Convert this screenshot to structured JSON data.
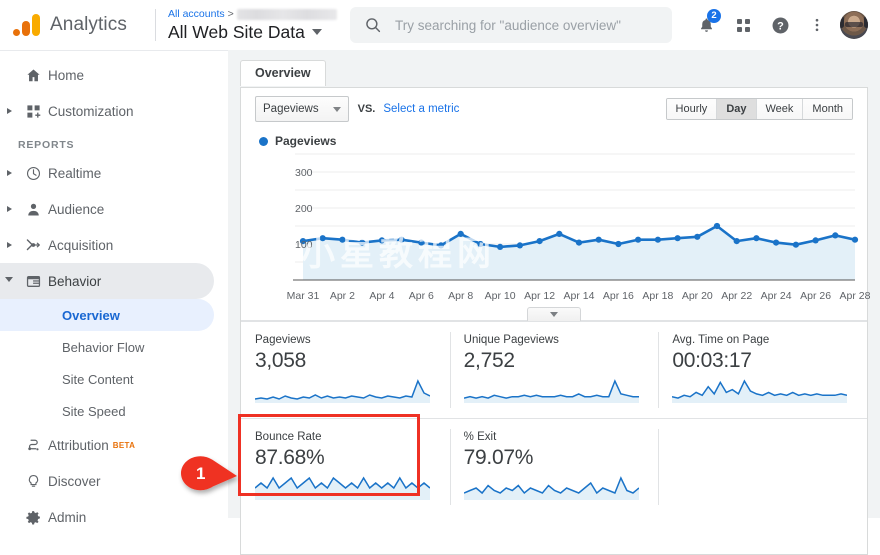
{
  "topbar": {
    "brand": "Analytics",
    "breadcrumb_root": "All accounts",
    "breadcrumb_sep": ">",
    "property_name": "All Web Site Data",
    "search_placeholder": "Try searching for \"audience overview\"",
    "notification_count": "2",
    "icons": {
      "search": "search-icon",
      "bell": "notifications-bell-icon",
      "apps": "apps-grid-icon",
      "help": "help-circle-icon",
      "more": "more-vertical-icon",
      "avatar": "user-avatar"
    }
  },
  "sidebar": {
    "top_items": [
      {
        "label": "Home",
        "icon": "home-icon",
        "expandable": false
      },
      {
        "label": "Customization",
        "icon": "customization-icon",
        "expandable": true
      }
    ],
    "section_label": "REPORTS",
    "report_items": [
      {
        "label": "Realtime",
        "icon": "clock-icon",
        "expandable": true
      },
      {
        "label": "Audience",
        "icon": "person-icon",
        "expandable": true
      },
      {
        "label": "Acquisition",
        "icon": "acquisition-icon",
        "expandable": true
      },
      {
        "label": "Behavior",
        "icon": "behavior-icon",
        "expandable": true,
        "expanded": true,
        "selected": true
      }
    ],
    "behavior_children": [
      {
        "label": "Overview",
        "active": true,
        "expandable": false
      },
      {
        "label": "Behavior Flow",
        "active": false,
        "expandable": false
      },
      {
        "label": "Site Content",
        "active": false,
        "expandable": true
      },
      {
        "label": "Site Speed",
        "active": false,
        "expandable": true
      }
    ],
    "bottom_items": [
      {
        "label": "Attribution",
        "icon": "attribution-icon",
        "badge": "BETA"
      },
      {
        "label": "Discover",
        "icon": "lightbulb-icon",
        "badge": ""
      },
      {
        "label": "Admin",
        "icon": "gear-icon",
        "badge": ""
      }
    ]
  },
  "main": {
    "tab_label": "Overview",
    "metric_select": "Pageviews",
    "vs_label": "VS.",
    "select_metric_link": "Select a metric",
    "granularity": [
      {
        "label": "Hourly",
        "selected": false
      },
      {
        "label": "Day",
        "selected": true
      },
      {
        "label": "Week",
        "selected": false
      },
      {
        "label": "Month",
        "selected": false
      }
    ],
    "legend_label": "Pageviews",
    "watermark": "小星教程网"
  },
  "metrics_row1": [
    {
      "title": "Pageviews",
      "value": "3,058"
    },
    {
      "title": "Unique Pageviews",
      "value": "2,752"
    },
    {
      "title": "Avg. Time on Page",
      "value": "00:03:17"
    }
  ],
  "metrics_row2": [
    {
      "title": "Bounce Rate",
      "value": "87.68%",
      "highlighted": true
    },
    {
      "title": "% Exit",
      "value": "79.07%",
      "highlighted": false
    }
  ],
  "annotation": {
    "number": "1",
    "color": "#ef3124"
  },
  "colors": {
    "line": "#1a73c8",
    "area": "#e3f0f8",
    "accent_blue": "#1a73e8",
    "highlight_red": "#ef3124",
    "beta_orange": "#e8710a"
  },
  "chart_data": {
    "type": "line",
    "title": "Pageviews",
    "xlabel": "",
    "ylabel": "",
    "ylim": [
      0,
      350
    ],
    "yticks": [
      100,
      200,
      300
    ],
    "grid": true,
    "legend": [
      "Pageviews"
    ],
    "legend_position": "top-left",
    "x": [
      "Mar 31",
      "Apr 1",
      "Apr 2",
      "Apr 3",
      "Apr 4",
      "Apr 5",
      "Apr 6",
      "Apr 7",
      "Apr 8",
      "Apr 9",
      "Apr 10",
      "Apr 11",
      "Apr 12",
      "Apr 13",
      "Apr 14",
      "Apr 15",
      "Apr 16",
      "Apr 17",
      "Apr 18",
      "Apr 19",
      "Apr 20",
      "Apr 21",
      "Apr 22",
      "Apr 23",
      "Apr 24",
      "Apr 25",
      "Apr 26",
      "Apr 27",
      "Apr 28"
    ],
    "tick_labels": [
      "Mar 31",
      "Apr 2",
      "Apr 4",
      "Apr 6",
      "Apr 8",
      "Apr 10",
      "Apr 12",
      "Apr 14",
      "Apr 16",
      "Apr 18",
      "Apr 20",
      "Apr 22",
      "Apr 24",
      "Apr 26",
      "Apr 28"
    ],
    "series": [
      {
        "name": "Pageviews",
        "values": [
          108,
          116,
          112,
          104,
          110,
          112,
          104,
          96,
          128,
          100,
          92,
          96,
          108,
          128,
          104,
          112,
          100,
          112,
          112,
          116,
          120,
          150,
          108,
          116,
          104,
          98,
          110,
          124,
          112
        ]
      }
    ],
    "sparklines": {
      "Pageviews": [
        10,
        11,
        10,
        12,
        10,
        13,
        11,
        10,
        12,
        11,
        14,
        11,
        13,
        11,
        12,
        11,
        13,
        12,
        11,
        14,
        12,
        11,
        13,
        12,
        11,
        13,
        12,
        28,
        16,
        13
      ],
      "Unique Pageviews": [
        10,
        11,
        10,
        11,
        10,
        12,
        11,
        10,
        11,
        11,
        12,
        11,
        12,
        11,
        11,
        11,
        12,
        11,
        11,
        13,
        11,
        11,
        12,
        11,
        11,
        22,
        13,
        12,
        11,
        11
      ],
      "Avg. Time on Page": [
        11,
        10,
        12,
        11,
        14,
        12,
        18,
        13,
        21,
        14,
        16,
        13,
        22,
        15,
        13,
        12,
        14,
        12,
        13,
        12,
        14,
        12,
        13,
        12,
        13,
        12,
        12,
        12,
        13,
        12
      ],
      "Bounce Rate": [
        12,
        13,
        12,
        14,
        12,
        13,
        14,
        12,
        13,
        14,
        12,
        13,
        12,
        14,
        13,
        12,
        13,
        12,
        14,
        12,
        13,
        12,
        13,
        12,
        14,
        12,
        13,
        12,
        13,
        12
      ],
      "% Exit": [
        12,
        13,
        14,
        12,
        15,
        13,
        12,
        14,
        13,
        15,
        12,
        14,
        13,
        12,
        15,
        13,
        12,
        14,
        13,
        12,
        14,
        16,
        12,
        14,
        13,
        12,
        18,
        13,
        12,
        14
      ]
    }
  }
}
